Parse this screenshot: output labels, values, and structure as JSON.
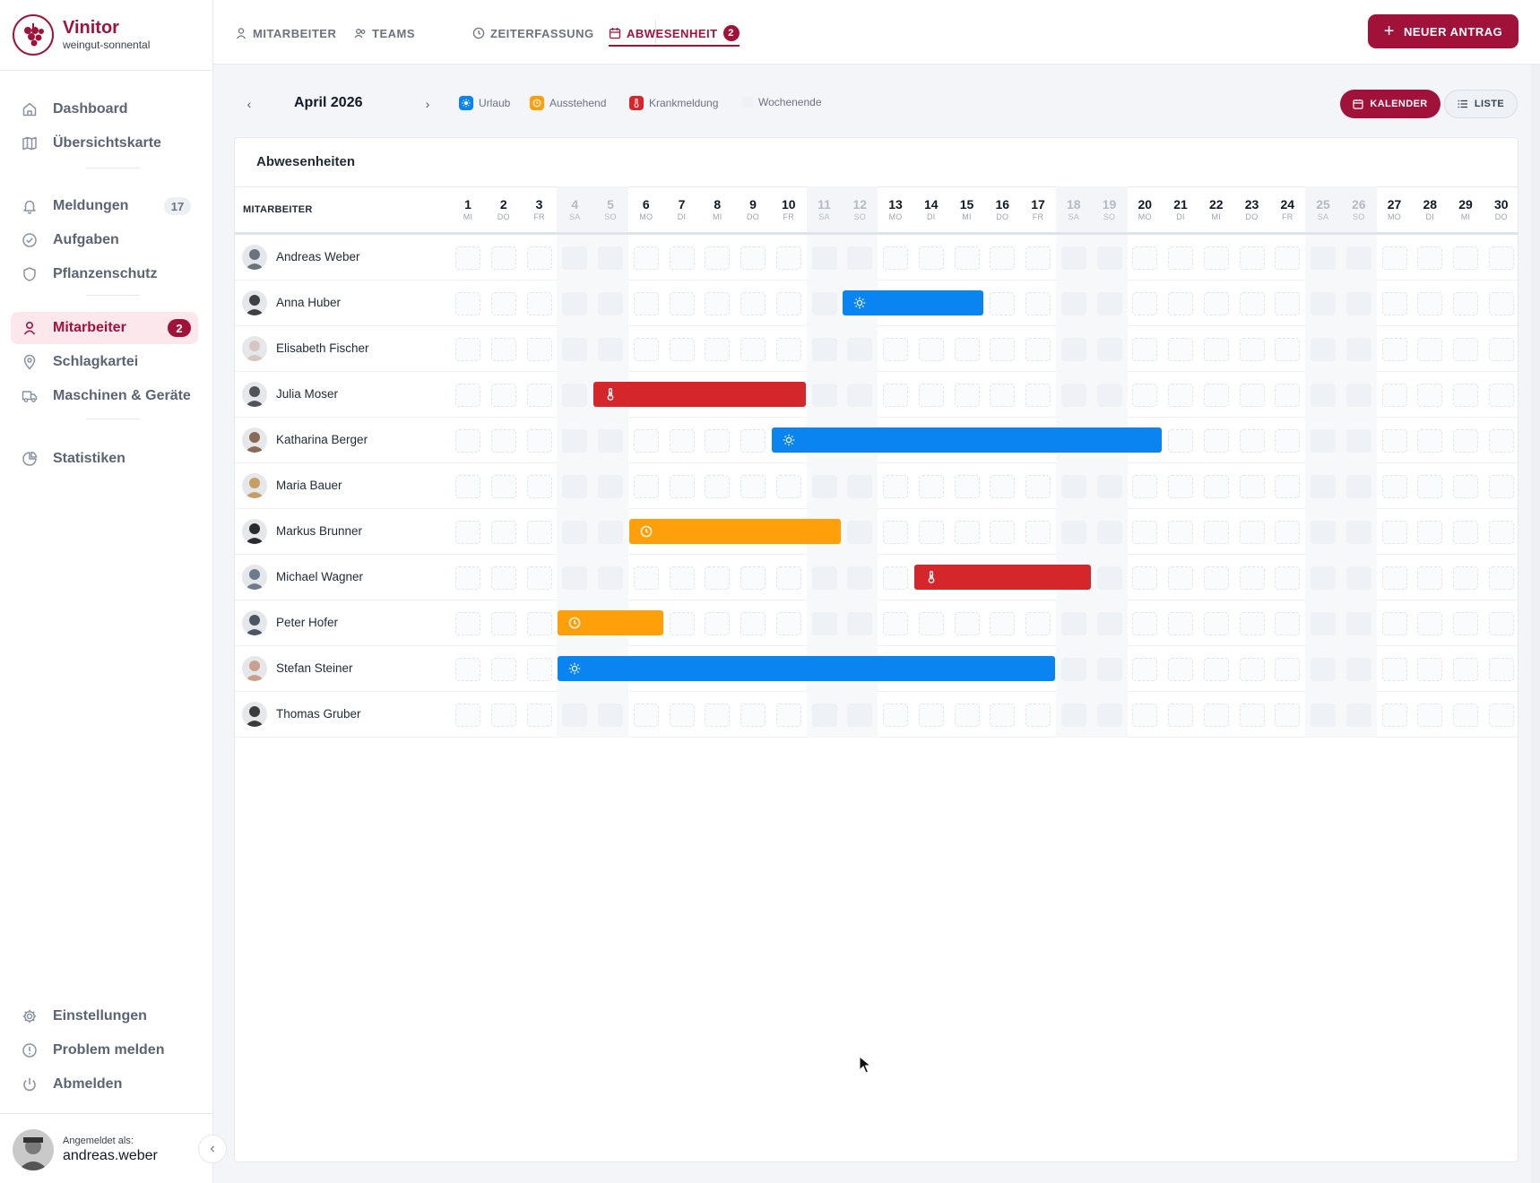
{
  "brand": {
    "name": "Vinitor",
    "subtitle": "weingut-sonnental"
  },
  "sidebar": {
    "items": [
      {
        "label": "Dashboard",
        "icon": "home-icon",
        "badge": ""
      },
      {
        "label": "Übersichtskarte",
        "icon": "map-icon",
        "badge": ""
      },
      {
        "label": "Meldungen",
        "icon": "bell-icon",
        "badge": "17"
      },
      {
        "label": "Aufgaben",
        "icon": "check-circle-icon",
        "badge": ""
      },
      {
        "label": "Pflanzenschutz",
        "icon": "shield-icon",
        "badge": ""
      },
      {
        "label": "Mitarbeiter",
        "icon": "user-icon",
        "badge": "2"
      },
      {
        "label": "Schlagkartei",
        "icon": "map-pin-icon",
        "badge": ""
      },
      {
        "label": "Maschinen & Geräte",
        "icon": "truck-icon",
        "badge": ""
      },
      {
        "label": "Statistiken",
        "icon": "pie-chart-icon",
        "badge": ""
      },
      {
        "label": "Einstellungen",
        "icon": "gear-icon",
        "badge": ""
      },
      {
        "label": "Problem melden",
        "icon": "alert-circle-icon",
        "badge": ""
      },
      {
        "label": "Abmelden",
        "icon": "power-icon",
        "badge": ""
      }
    ],
    "active_index": 5
  },
  "user": {
    "label": "Angemeldet als:",
    "name": "andreas.weber"
  },
  "tabs": [
    {
      "label": "MITARBEITER",
      "icon": "user-icon"
    },
    {
      "label": "TEAMS",
      "icon": "users-icon"
    },
    {
      "label": "ZEITERFASSUNG",
      "icon": "clock-icon"
    },
    {
      "label": "ABWESENHEIT",
      "icon": "calendar-icon",
      "badge": "2"
    }
  ],
  "primary_button": {
    "label": "NEUER ANTRAG"
  },
  "toolbar": {
    "month": "April 2026",
    "legend": [
      {
        "label": "Urlaub",
        "color": "#0a84f0",
        "icon": "sun-icon"
      },
      {
        "label": "Ausstehend",
        "color": "#ff9f0a",
        "icon": "clock-icon"
      },
      {
        "label": "Krankmeldung",
        "color": "#d4262b",
        "icon": "thermometer-icon"
      },
      {
        "label": "Wochenende",
        "color": "#eef1f5",
        "icon": ""
      }
    ],
    "view_calendar": "KALENDER",
    "view_list": "LISTE"
  },
  "card": {
    "title": "Abwesenheiten",
    "employee_col": "MITARBEITER"
  },
  "days": [
    {
      "n": "1",
      "w": "MI"
    },
    {
      "n": "2",
      "w": "DO"
    },
    {
      "n": "3",
      "w": "FR"
    },
    {
      "n": "4",
      "w": "SA"
    },
    {
      "n": "5",
      "w": "SO"
    },
    {
      "n": "6",
      "w": "MO"
    },
    {
      "n": "7",
      "w": "DI"
    },
    {
      "n": "8",
      "w": "MI"
    },
    {
      "n": "9",
      "w": "DO"
    },
    {
      "n": "10",
      "w": "FR"
    },
    {
      "n": "11",
      "w": "SA"
    },
    {
      "n": "12",
      "w": "SO"
    },
    {
      "n": "13",
      "w": "MO"
    },
    {
      "n": "14",
      "w": "DI"
    },
    {
      "n": "15",
      "w": "MI"
    },
    {
      "n": "16",
      "w": "DO"
    },
    {
      "n": "17",
      "w": "FR"
    },
    {
      "n": "18",
      "w": "SA"
    },
    {
      "n": "19",
      "w": "SO"
    },
    {
      "n": "20",
      "w": "MO"
    },
    {
      "n": "21",
      "w": "DI"
    },
    {
      "n": "22",
      "w": "MI"
    },
    {
      "n": "23",
      "w": "DO"
    },
    {
      "n": "24",
      "w": "FR"
    },
    {
      "n": "25",
      "w": "SA"
    },
    {
      "n": "26",
      "w": "SO"
    },
    {
      "n": "27",
      "w": "MO"
    },
    {
      "n": "28",
      "w": "DI"
    },
    {
      "n": "29",
      "w": "MI"
    },
    {
      "n": "30",
      "w": "DO"
    }
  ],
  "absence_types": {
    "urlaub": {
      "color": "#0a84f0",
      "icon": "sun-icon"
    },
    "ausstehend": {
      "color": "#ff9f0a",
      "icon": "clock-icon"
    },
    "krank": {
      "color": "#d4262b",
      "icon": "thermometer-icon"
    }
  },
  "employees": [
    {
      "name": "Andreas Weber",
      "absences": []
    },
    {
      "name": "Anna Huber",
      "absences": [
        {
          "type": "urlaub",
          "from": 12,
          "to": 15
        }
      ]
    },
    {
      "name": "Elisabeth Fischer",
      "absences": []
    },
    {
      "name": "Julia Moser",
      "absences": [
        {
          "type": "krank",
          "from": 5,
          "to": 10
        }
      ]
    },
    {
      "name": "Katharina Berger",
      "absences": [
        {
          "type": "urlaub",
          "from": 10,
          "to": 20
        }
      ]
    },
    {
      "name": "Maria Bauer",
      "absences": []
    },
    {
      "name": "Markus Brunner",
      "absences": [
        {
          "type": "ausstehend",
          "from": 6,
          "to": 11
        }
      ]
    },
    {
      "name": "Michael Wagner",
      "absences": [
        {
          "type": "krank",
          "from": 14,
          "to": 18
        }
      ]
    },
    {
      "name": "Peter Hofer",
      "absences": [
        {
          "type": "ausstehend",
          "from": 4,
          "to": 6
        }
      ]
    },
    {
      "name": "Stefan Steiner",
      "absences": [
        {
          "type": "urlaub",
          "from": 4,
          "to": 17
        }
      ]
    },
    {
      "name": "Thomas Gruber",
      "absences": []
    }
  ]
}
